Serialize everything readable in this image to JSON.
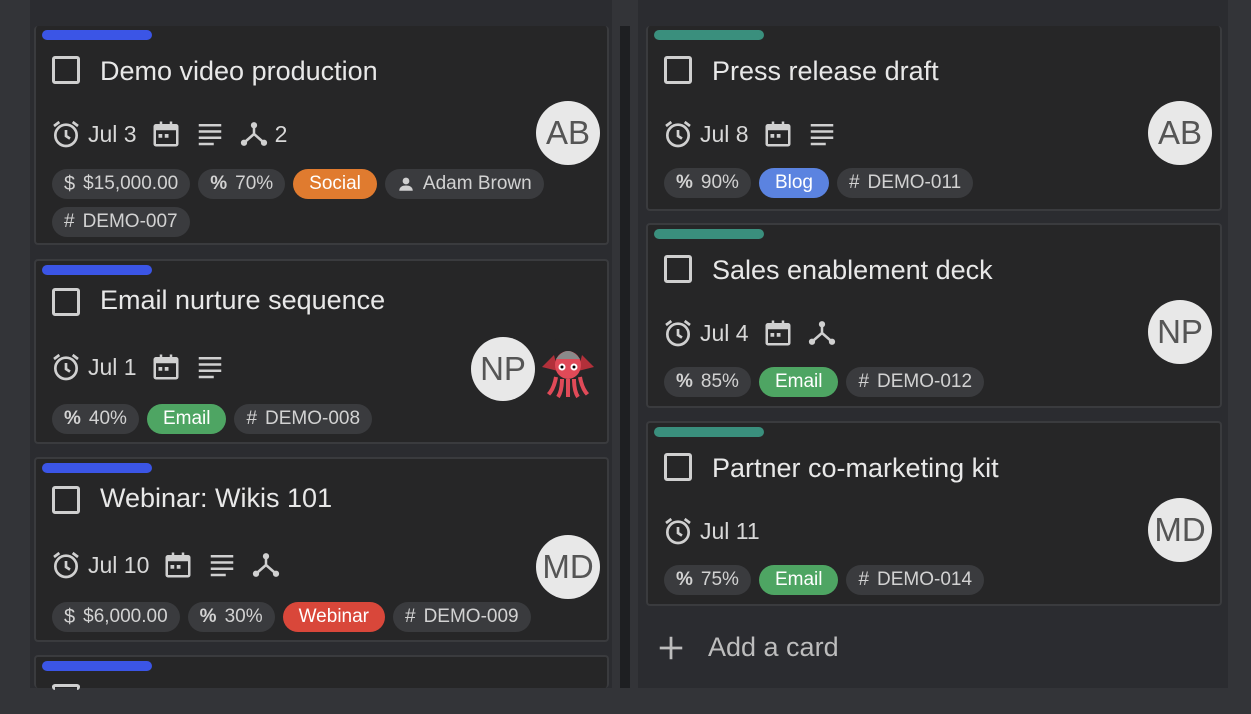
{
  "colors": {
    "blue_label": "#3b55e6",
    "teal_label": "#3a8f7d",
    "social": "#e07b2f",
    "email": "#4ea563",
    "webinar": "#d9473a",
    "blog": "#5b83e0"
  },
  "left_cards": [
    {
      "title": "Demo video production",
      "due": "Jul 3",
      "subtasks": "2",
      "amount": "$15,000.00",
      "progress": "70%",
      "tag": "Social",
      "assignee": "Adam Brown",
      "id": "DEMO-007",
      "avatar": "AB"
    },
    {
      "title": "Email nurture sequence",
      "due": "Jul 1",
      "progress": "40%",
      "tag": "Email",
      "id": "DEMO-008",
      "avatar": "NP"
    },
    {
      "title": "Webinar: Wikis 101",
      "due": "Jul 10",
      "amount": "$6,000.00",
      "progress": "30%",
      "tag": "Webinar",
      "id": "DEMO-009",
      "avatar": "MD"
    }
  ],
  "right_cards": [
    {
      "title": "Press release draft",
      "due": "Jul 8",
      "progress": "90%",
      "tag": "Blog",
      "id": "DEMO-011",
      "avatar": "AB"
    },
    {
      "title": "Sales enablement deck",
      "due": "Jul 4",
      "progress": "85%",
      "tag": "Email",
      "id": "DEMO-012",
      "avatar": "NP"
    },
    {
      "title": "Partner co-marketing kit",
      "due": "Jul 11",
      "progress": "75%",
      "tag": "Email",
      "id": "DEMO-014",
      "avatar": "MD"
    }
  ],
  "add_card_label": "Add a card",
  "icons": [
    "alarm-icon",
    "calendar-icon",
    "description-icon",
    "subtasks-icon",
    "dollar-icon",
    "percent-icon",
    "person-icon",
    "hash-icon",
    "plus-icon",
    "checkbox-icon",
    "monster-avatar-icon"
  ]
}
